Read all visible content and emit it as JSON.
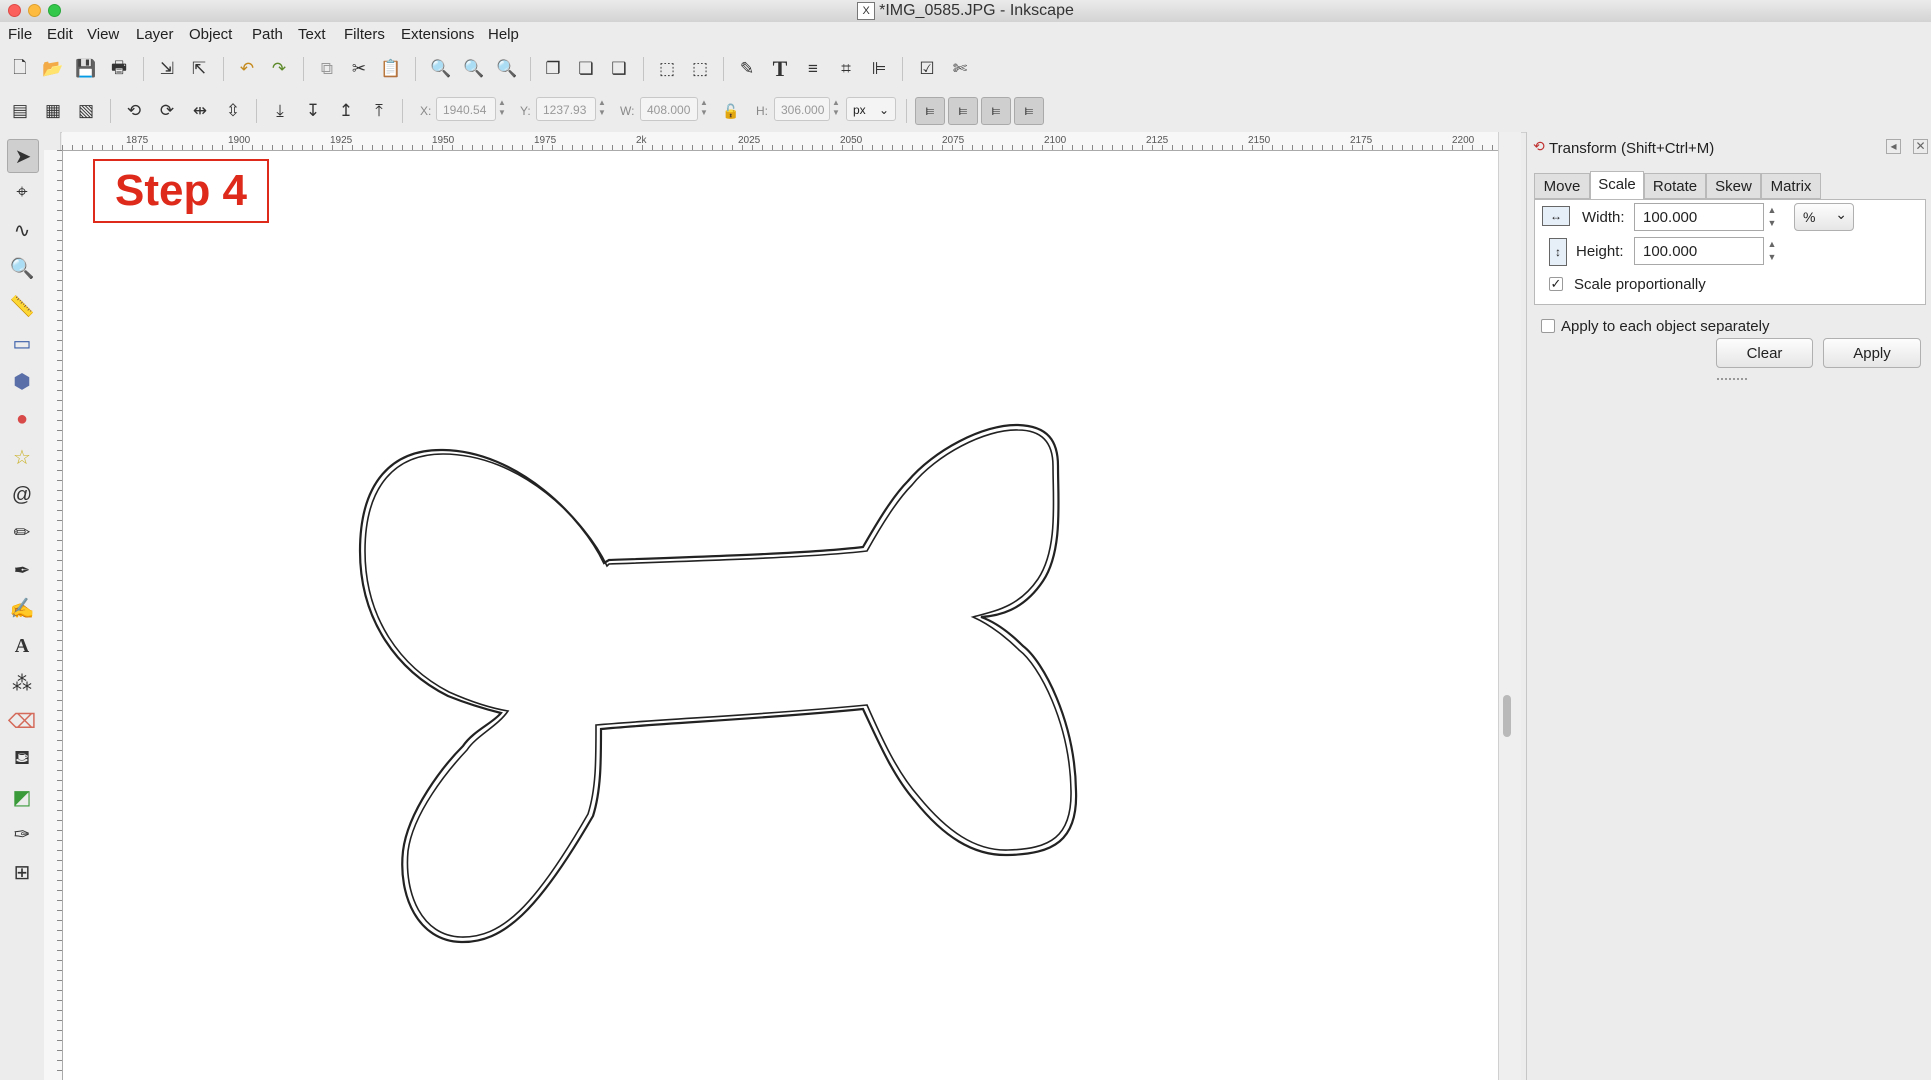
{
  "window": {
    "title": "*IMG_0585.JPG - Inkscape",
    "x_badge": "X"
  },
  "menu": [
    "File",
    "Edit",
    "View",
    "Layer",
    "Object",
    "Path",
    "Text",
    "Filters",
    "Extensions",
    "Help"
  ],
  "controls": {
    "x_label": "X:",
    "x_value": "1940.54",
    "y_label": "Y:",
    "y_value": "1237.93",
    "w_label": "W:",
    "w_value": "408.000",
    "h_label": "H:",
    "h_value": "306.000",
    "unit": "px"
  },
  "ruler": {
    "h_ticks": [
      "1875",
      "1900",
      "1925",
      "1950",
      "1975",
      "2k",
      "2025",
      "2050",
      "2075",
      "2100",
      "2125",
      "2150",
      "2175",
      "2200"
    ]
  },
  "canvas": {
    "step_label": "Step 4",
    "step_color": "#dd2a1b"
  },
  "transform": {
    "title": "Transform (Shift+Ctrl+M)",
    "tabs": [
      "Move",
      "Scale",
      "Rotate",
      "Skew",
      "Matrix"
    ],
    "active_tab": "Scale",
    "width_label": "Width:",
    "width_value": "100.000",
    "height_label": "Height:",
    "height_value": "100.000",
    "unit": "%",
    "scale_proportionally": "Scale proportionally",
    "scale_proportionally_checked": true,
    "apply_each": "Apply to each object separately",
    "apply_each_checked": false,
    "clear_label": "Clear",
    "apply_label": "Apply"
  }
}
